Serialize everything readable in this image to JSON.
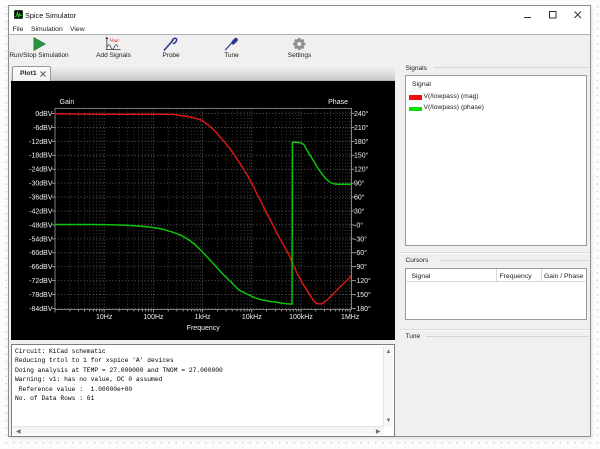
{
  "app": {
    "title": "Spice Simulator"
  },
  "menu": {
    "items": [
      "File",
      "Simulation",
      "View"
    ]
  },
  "toolbar": {
    "buttons": [
      {
        "label": "Run/Stop Simulation"
      },
      {
        "label": "Add Signals",
        "icon_text": "Vout"
      },
      {
        "label": "Probe"
      },
      {
        "label": "Tune"
      },
      {
        "label": "Settings"
      }
    ]
  },
  "plot_tab": {
    "label": "Plot1"
  },
  "chart_data": {
    "type": "line",
    "title": "",
    "background": "#000000",
    "grid": true,
    "x_axis": {
      "label": "Frequency",
      "scale": "log",
      "min_hz": 1,
      "max_hz": 1000000,
      "ticks": [
        {
          "f": 10,
          "label": "10Hz"
        },
        {
          "f": 100,
          "label": "100Hz"
        },
        {
          "f": 1000,
          "label": "1kHz"
        },
        {
          "f": 10000,
          "label": "10kHz"
        },
        {
          "f": 100000,
          "label": "100kHz"
        },
        {
          "f": 1000000,
          "label": "1MHz"
        }
      ]
    },
    "y_axis_left": {
      "label": "Gain",
      "unit": "dBV",
      "min": -84,
      "max": 0,
      "step": 6,
      "tick_values": [
        0,
        -6,
        -12,
        -18,
        -24,
        -30,
        -36,
        -42,
        -48,
        -54,
        -60,
        -66,
        -72,
        -78,
        -84
      ],
      "tick_labels": [
        "0dBV",
        "-6dBV",
        "-12dBV",
        "-18dBV",
        "-24dBV",
        "-30dBV",
        "-36dBV",
        "-42dBV",
        "-48dBV",
        "-54dBV",
        "-60dBV",
        "-66dBV",
        "-72dBV",
        "-78dBV",
        "-84dBV"
      ]
    },
    "y_axis_right": {
      "label": "Phase",
      "unit": "deg",
      "min": -180,
      "max": 240,
      "step": 30,
      "tick_values": [
        240,
        210,
        180,
        150,
        120,
        90,
        60,
        30,
        0,
        -30,
        -60,
        -90,
        -120,
        -150,
        -180
      ],
      "tick_labels": [
        "240°",
        "210°",
        "180°",
        "150°",
        "120°",
        "90°",
        "60°",
        "30°",
        "-0°",
        "-30°",
        "-60°",
        "-90°",
        "-120°",
        "-150°",
        "-180°"
      ]
    },
    "series": [
      {
        "name": "V(/lowpass) (mag)",
        "axis": "left",
        "color": "#d81616",
        "unit": "dBV",
        "points": [
          [
            1.0,
            -0.1
          ],
          [
            8.6,
            -0.3
          ],
          [
            56.0,
            -0.3
          ],
          [
            143,
            -0.3
          ],
          [
            262,
            -0.4
          ],
          [
            364,
            -0.9
          ],
          [
            505,
            -1.3
          ],
          [
            669,
            -1.9
          ],
          [
            928,
            -2.8
          ],
          [
            1195,
            -4.3
          ],
          [
            1482,
            -5.9
          ],
          [
            1846,
            -7.9
          ],
          [
            2300,
            -10.2
          ],
          [
            2866,
            -12.6
          ],
          [
            3555,
            -15.0
          ],
          [
            4347,
            -17.7
          ],
          [
            5493,
            -20.8
          ],
          [
            6624,
            -23.5
          ],
          [
            8371,
            -27.1
          ],
          [
            10189,
            -30.4
          ],
          [
            12755,
            -34.7
          ],
          [
            15381,
            -37.9
          ],
          [
            18548,
            -41.7
          ],
          [
            22366,
            -44.8
          ],
          [
            27097,
            -48.2
          ],
          [
            32523,
            -51.5
          ],
          [
            39403,
            -54.8
          ],
          [
            47293,
            -57.8
          ],
          [
            57297,
            -61.0
          ],
          [
            70398,
            -65.5
          ],
          [
            84100,
            -69.0
          ],
          [
            113469,
            -74.0
          ],
          [
            152380,
            -78.3
          ],
          [
            182038,
            -80.8
          ],
          [
            206557,
            -81.8
          ],
          [
            232195,
            -82.0
          ],
          [
            261016,
            -82.0
          ],
          [
            293413,
            -81.4
          ],
          [
            329832,
            -80.5
          ],
          [
            407152,
            -78.7
          ],
          [
            514496,
            -76.5
          ],
          [
            650142,
            -74.3
          ],
          [
            821550,
            -72.2
          ],
          [
            976871,
            -70.7
          ],
          [
            1000000,
            -70.1
          ]
        ]
      },
      {
        "name": "V(/lowpass) (phase)",
        "axis": "right",
        "color": "#0cc40c",
        "unit": "deg",
        "points": [
          [
            1.0,
            0.9
          ],
          [
            5.4,
            0.9
          ],
          [
            13.7,
            0.5
          ],
          [
            27.7,
            -0.6
          ],
          [
            56.0,
            -2.7
          ],
          [
            89.4,
            -5.1
          ],
          [
            130,
            -7.7
          ],
          [
            180,
            -11.3
          ],
          [
            250,
            -15.9
          ],
          [
            364,
            -22.3
          ],
          [
            505,
            -30.9
          ],
          [
            701,
            -42.1
          ],
          [
            972,
            -57.2
          ],
          [
            1349,
            -73.4
          ],
          [
            1872,
            -89.5
          ],
          [
            2598,
            -106.3
          ],
          [
            3778,
            -122.9
          ],
          [
            5493,
            -140.3
          ],
          [
            6942,
            -145.5
          ],
          [
            8772,
            -150.9
          ],
          [
            10578,
            -155.2
          ],
          [
            13366,
            -159.1
          ],
          [
            16890,
            -161.9
          ],
          [
            21344,
            -163.8
          ],
          [
            26971,
            -165.3
          ],
          [
            34082,
            -167.0
          ],
          [
            41098,
            -168.5
          ],
          [
            51933,
            -169.8
          ],
          [
            65626,
            -170.5
          ],
          [
            67000,
            178.2
          ],
          [
            82928,
            178.0
          ],
          [
            100000,
            176.7
          ],
          [
            115074,
            172.8
          ],
          [
            132419,
            160.5
          ],
          [
            155987,
            148.9
          ],
          [
            181188,
            137.5
          ],
          [
            211448,
            125.6
          ],
          [
            247919,
            114.4
          ],
          [
            298958,
            103.0
          ],
          [
            360504,
            94.4
          ],
          [
            436761,
            89.2
          ],
          [
            539147,
            87.7
          ],
          [
            748141,
            87.5
          ],
          [
            1000000,
            87.5
          ]
        ]
      }
    ]
  },
  "signals_panel": {
    "title": "Signals",
    "column_header": "Signal",
    "rows": [
      {
        "name": "V(/lowpass) (mag)",
        "color": "#ed0e0e"
      },
      {
        "name": "V(/lowpass) (phase)",
        "color": "#0ae00a"
      }
    ]
  },
  "cursors_panel": {
    "title": "Cursors",
    "columns": [
      "Signal",
      "Frequency",
      "Gain / Phase"
    ],
    "rows": []
  },
  "tune_panel": {
    "title": "Tune"
  },
  "console": {
    "lines": [
      "Circuit: KiCad schematic",
      "Reducing trtol to 1 for xspice 'A' devices",
      "Doing analysis at TEMP = 27.000000 and TNOM = 27.000000",
      "Warning: v1: has no value, DC 0 assumed",
      " Reference value :  1.00000e+00",
      "No. of Data Rows : 61"
    ]
  }
}
